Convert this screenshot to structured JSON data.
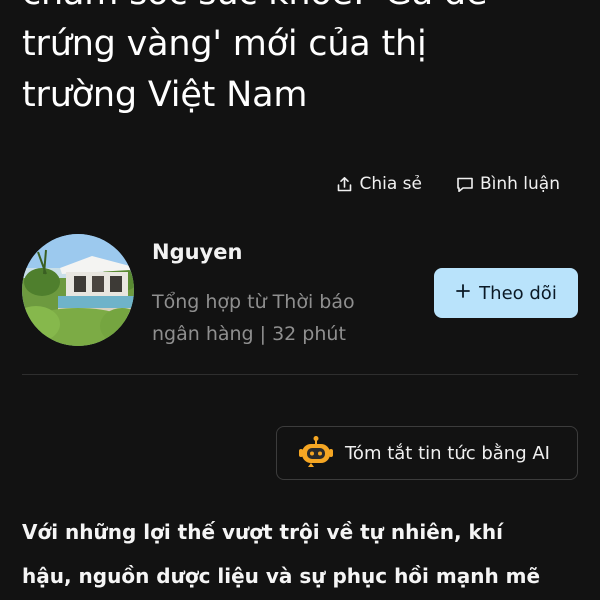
{
  "article": {
    "title_lines": [
      "chăm sóc sức khỏe: 'Gà đẻ",
      "trứng vàng' mới của thị",
      "trường Việt Nam"
    ]
  },
  "actions": {
    "share_label": "Chia sẻ",
    "comment_label": "Bình luận"
  },
  "author": {
    "name": "Nguyen",
    "meta_lines": [
      "Tổng hợp từ Thời báo",
      "ngân hàng | 32 phút"
    ],
    "follow_label": "Theo dõi"
  },
  "ai_summary": {
    "label": "Tóm tắt tin tức bằng AI"
  },
  "body": {
    "lines": [
      "Với những lợi thế vượt trội về tự nhiên, khí",
      "hậu, nguồn dược liệu và sự phục hồi mạnh mẽ"
    ]
  },
  "colors": {
    "background": "#121212",
    "follow_button": "#b9e3fb",
    "muted_text": "#8f8f8f",
    "ai_icon": "#f5a623"
  },
  "icons": [
    "share-icon",
    "comment-icon",
    "plus-icon",
    "ai-bot-icon"
  ]
}
